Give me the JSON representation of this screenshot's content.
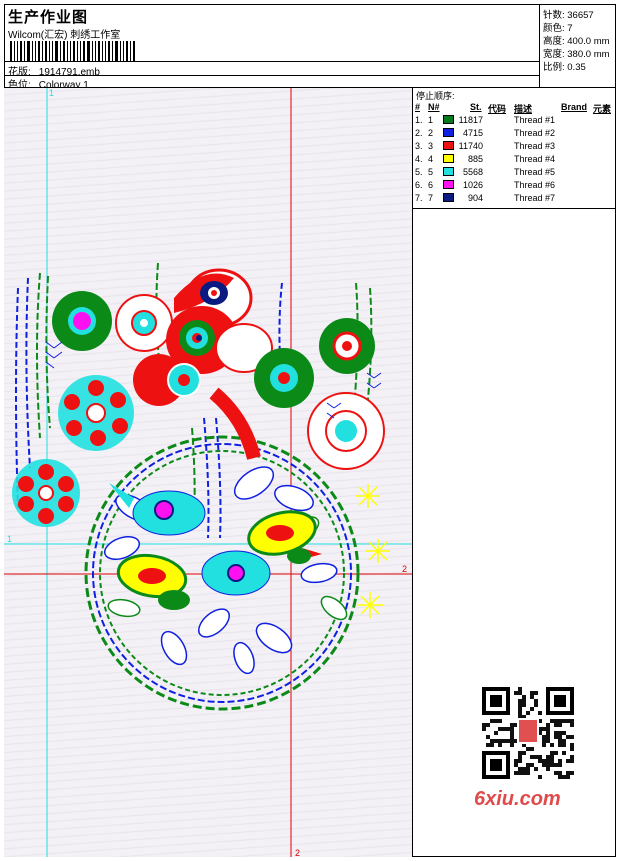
{
  "header": {
    "title": "生产作业图",
    "studio": "Wilcom(汇宏) 刺绣工作室",
    "design_label": "花版:",
    "design_value": "1914791.emb",
    "colorway_label": "色位:",
    "colorway_value": "Colorway 1"
  },
  "specs": {
    "stitches": "针数: 36657",
    "colors": "颜色: 7",
    "height": "高度: 400.0 mm",
    "width": "宽度: 380.0 mm",
    "scale": "比例: 0.35"
  },
  "stop_sequence": {
    "title": "停止顺序:",
    "headers": {
      "num": "#",
      "needle": "N#",
      "stitches": "St.",
      "code": "代码",
      "desc": "描述",
      "brand": "Brand",
      "element": "元素"
    },
    "rows": [
      {
        "num": "1.",
        "needle": "1",
        "color": "#007a1a",
        "stitches": "11817",
        "desc": "Thread #1"
      },
      {
        "num": "2.",
        "needle": "2",
        "color": "#1020e0",
        "stitches": "4715",
        "desc": "Thread #2"
      },
      {
        "num": "3.",
        "needle": "3",
        "color": "#ee1111",
        "stitches": "11740",
        "desc": "Thread #3"
      },
      {
        "num": "4.",
        "needle": "4",
        "color": "#ffff00",
        "stitches": "885",
        "desc": "Thread #4"
      },
      {
        "num": "5.",
        "needle": "5",
        "color": "#22e0e0",
        "stitches": "5568",
        "desc": "Thread #5"
      },
      {
        "num": "6.",
        "needle": "6",
        "color": "#ff10f0",
        "stitches": "1026",
        "desc": "Thread #6"
      },
      {
        "num": "7.",
        "needle": "7",
        "color": "#0a1a80",
        "stitches": "904",
        "desc": "Thread #7"
      }
    ]
  },
  "guides": {
    "v_cyan": "1",
    "h_cyan": "1",
    "v_red": "2",
    "h_red": "2"
  },
  "watermark": {
    "text": "6xiu.com"
  },
  "colors": {
    "green": "#0c8a18",
    "blue": "#1020e0",
    "red": "#ee1111",
    "yellow": "#ffff00",
    "cyan": "#22e0e0",
    "magenta": "#ff10f0",
    "navy": "#0a1a80"
  }
}
